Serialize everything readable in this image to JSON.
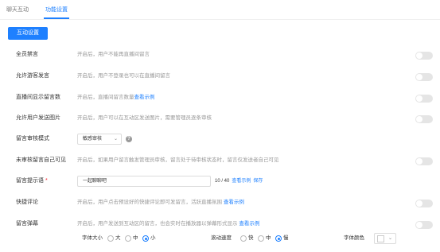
{
  "tabs": [
    {
      "label": "聊天互动"
    },
    {
      "label": "功能设置"
    }
  ],
  "section_button": "互动设置",
  "rows": [
    {
      "label": "全员禁言",
      "desc": "开启后，用户不能再直播间留言"
    },
    {
      "label": "允许游客发言",
      "desc": "开启后，用户不登录也可以在直播间留言"
    },
    {
      "label": "直播间显示留言数",
      "desc": "开启后，直播间留言数量",
      "link": "查看示例"
    },
    {
      "label": "允许用户发送图片",
      "desc": "开启后，用户可以在互动区发送图片，需要管理员逐条审核"
    },
    {
      "label": "留言审核模式",
      "select": "敏感审核",
      "select_arrow": "⌄",
      "help": "?"
    },
    {
      "label": "未审核留言自己可见",
      "desc": "开启后，如果用户留言触发管理员审核，留言处于待审核状态时，留言仅发送者自己可见"
    },
    {
      "label": "留言提示语",
      "required": "*",
      "input_value": "一起聊聊吧",
      "counter": "10 / 40",
      "link": "查看示例",
      "save": "保存"
    },
    {
      "label": "快捷评论",
      "desc": "开启后，用户点击预设好的快捷评论即可发留言，活跃直播氛围",
      "link": "查看示例"
    },
    {
      "label": "留言弹幕",
      "desc": "开启后，用户发送到互动区的留言，也会实时在播放器以弹幕形式显示",
      "link": "查看示例"
    }
  ],
  "danmaku": {
    "font_size_label": "字体大小",
    "font_size_options": [
      "大",
      "中",
      "小"
    ],
    "font_size_selected": "小",
    "speed_label": "滚动速度",
    "speed_options": [
      "快",
      "中",
      "慢"
    ],
    "speed_selected": "慢",
    "color_label": "字体颜色",
    "color_value": "#ffffff",
    "color_arrow": "⌄"
  },
  "colors": {
    "accent": "#1e80ff",
    "toggle_off": "#e5e5e5",
    "muted_text": "#999999"
  }
}
